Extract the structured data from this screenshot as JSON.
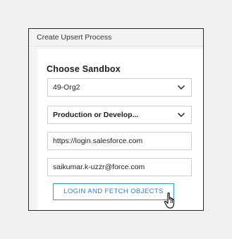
{
  "window": {
    "title": "Create Upsert Process"
  },
  "section": {
    "heading": "Choose Sandbox"
  },
  "sandbox_select": {
    "value": "49-Org2",
    "icon": "chevron-down-icon"
  },
  "env_select": {
    "value": "Production or Develop...",
    "icon": "chevron-down-icon"
  },
  "url_input": {
    "value": "https://login.salesforce.com"
  },
  "username_input": {
    "value": "saikumar.k-uzzr@force.com"
  },
  "login_button": {
    "label": "LOGIN AND FETCH OBJECTS"
  },
  "cursor": {
    "icon": "hand-pointer-icon"
  },
  "colors": {
    "accent": "#2f9bd6",
    "accent_text": "#2f7fbf",
    "border": "#cfcfcf"
  }
}
